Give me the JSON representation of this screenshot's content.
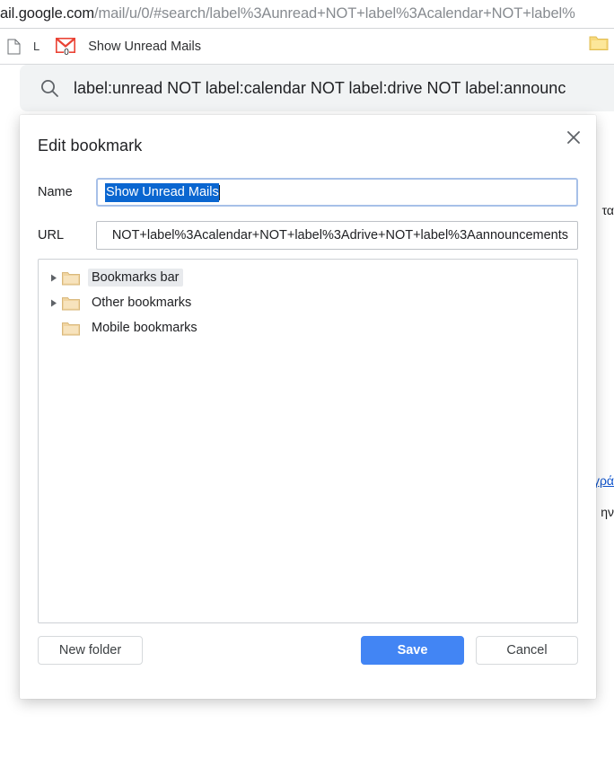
{
  "browser": {
    "omnibox": {
      "host_text": "ail.google.com",
      "path_text": "/mail/u/0/#search/label%3Aunread+NOT+label%3Acalendar+NOT+label%",
      "full_visible": "ail.google.com/mail/u/0/#search/label%3Aunread+NOT+label%3Acalendar+NOT+label%"
    },
    "bookmarks_bar": {
      "doc_icon": "document-icon",
      "letter_item": "L",
      "gmail_icon": "gmail-icon",
      "gmail_badge": "0",
      "bookmark_label": "Show Unread Mails",
      "right_folder_icon": "folder-icon"
    }
  },
  "page": {
    "search": {
      "icon": "search-icon",
      "query": "label:unread NOT label:calendar NOT label:drive NOT label:announc"
    },
    "fragments": {
      "ta": "τα",
      "grey": "γρά",
      "in": "ην"
    }
  },
  "dialog": {
    "title": "Edit bookmark",
    "close_icon": "close-icon",
    "name": {
      "label": "Name",
      "value": "Show Unread Mails",
      "placeholder": "Name"
    },
    "url": {
      "label": "URL",
      "value": "NOT+label%3Acalendar+NOT+label%3Adrive+NOT+label%3Aannouncements",
      "placeholder": "URL"
    },
    "tree": {
      "items": [
        {
          "label": "Bookmarks bar",
          "expandable": true,
          "selected": true,
          "icon": "folder-icon"
        },
        {
          "label": "Other bookmarks",
          "expandable": true,
          "selected": false,
          "icon": "folder-icon"
        },
        {
          "label": "Mobile bookmarks",
          "expandable": false,
          "selected": false,
          "icon": "folder-icon"
        }
      ]
    },
    "buttons": {
      "new_folder": "New folder",
      "save": "Save",
      "cancel": "Cancel"
    },
    "colors": {
      "primary": "#4285f4",
      "selection": "#0a66d0",
      "folder": "#f5d28a"
    }
  }
}
